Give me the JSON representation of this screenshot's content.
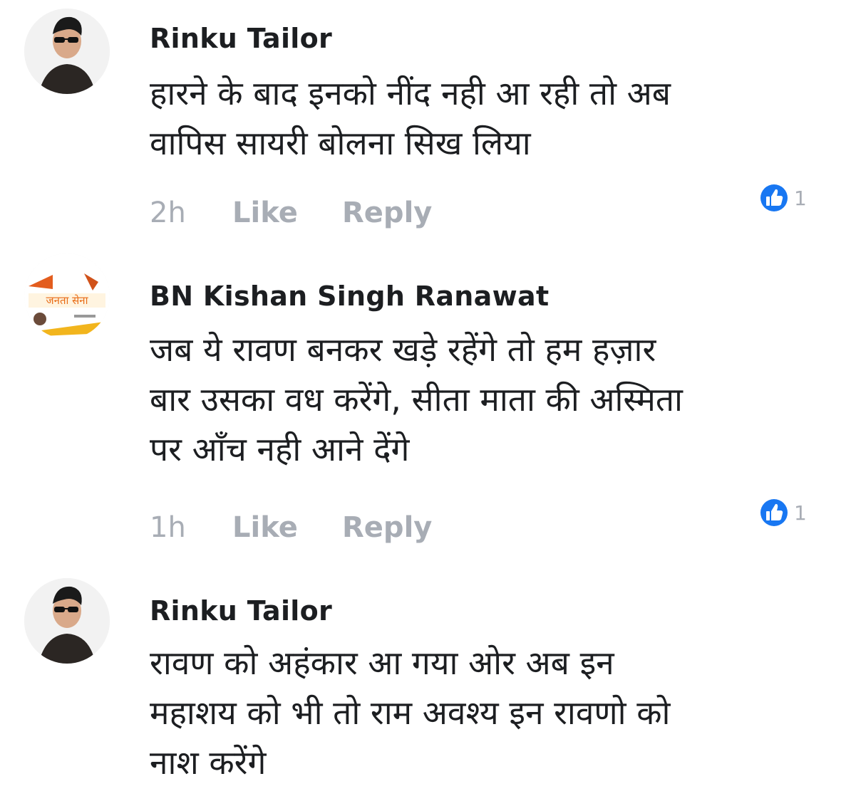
{
  "comments": [
    {
      "author": "Rinku Tailor",
      "avatar_icon": "profile-photo-man-sunglasses",
      "lines": [
        "हारने के बाद इनको नींद नही आ रही तो अब",
        "वापिस सायरी बोलना सिख लिया"
      ],
      "time": "2h",
      "like_label": "Like",
      "reply_label": "Reply",
      "reaction_icon": "like-thumb-icon",
      "reaction_count": "1"
    },
    {
      "author": "BN Kishan Singh Ranawat",
      "avatar_icon": "profile-photo-janta-sena-logo",
      "avatar_text": "जनता सेना",
      "lines": [
        "जब ये रावण बनकर खड़े रहेंगे तो हम हज़ार",
        "बार उसका वध करेंगे, सीता माता की अस्मिता",
        "पर आँच नही आने देंगे"
      ],
      "time": "1h",
      "like_label": "Like",
      "reply_label": "Reply",
      "reaction_icon": "like-thumb-icon",
      "reaction_count": "1"
    },
    {
      "author": "Rinku Tailor",
      "avatar_icon": "profile-photo-man-sunglasses",
      "lines": [
        "रावण को अहंकार आ गया ओर अब इन",
        "महाशय को भी तो राम अवश्य इन रावणो को",
        "नाश करेंगे"
      ]
    }
  ],
  "colors": {
    "like_blue": "#1877f2",
    "meta_gray": "#a8adb5",
    "text": "#1c1e21"
  }
}
